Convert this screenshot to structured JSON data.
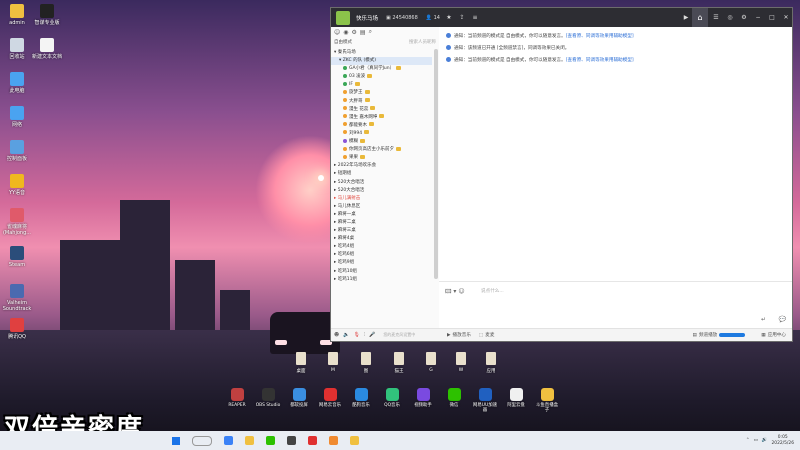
{
  "desktop_icons": [
    {
      "label": "admin",
      "color": "#f0c040"
    },
    {
      "label": "回收站",
      "color": "#cfd8e3"
    },
    {
      "label": "此电脑",
      "color": "#4aa3f0"
    },
    {
      "label": "网络",
      "color": "#4aa3f0"
    },
    {
      "label": "控制面板",
      "color": "#5aa0e0"
    },
    {
      "label": "YY语音",
      "color": "#f0b81e"
    },
    {
      "label": "雀魂麻将 (Mahjong...",
      "color": "#e05a6a"
    },
    {
      "label": "Steam",
      "color": "#2b4d7a"
    },
    {
      "label": "Valheim Soundtrack",
      "color": "#4a6ab0"
    },
    {
      "label": "腾讯QQ",
      "color": "#e04040"
    }
  ],
  "desktop_icons_col2": [
    {
      "label": "智谋专业版",
      "color": "#222"
    },
    {
      "label": "新建文本文档",
      "color": "#f4f4f4"
    }
  ],
  "qq": {
    "title": "快乐马场",
    "id": "24540868",
    "members": "14",
    "sidebar_mode": "自由模式",
    "sidebar_search_hint": "搜索人员昵称",
    "channel_main": "秦氏马场",
    "channel_sub": "ZKC 的队 (模式)",
    "members_list": [
      {
        "name": "GA小君（真同学Jun）",
        "dot": "#3aa757"
      },
      {
        "name": "03 凌波",
        "dot": "#3aa757"
      },
      {
        "name": "IF",
        "dot": "#3aa757"
      },
      {
        "name": "旋梦王",
        "dot": "#f0a030"
      },
      {
        "name": "大胖哥",
        "dot": "#f0a030"
      },
      {
        "name": "漫生 花蕊",
        "dot": "#f0a030"
      },
      {
        "name": "漫生 嘉木网坤",
        "dot": "#f0a030"
      },
      {
        "name": "都能要木",
        "dot": "#f0a030"
      },
      {
        "name": "刘994",
        "dot": "#f0a030"
      },
      {
        "name": "模糊",
        "dot": "#8a55d8"
      },
      {
        "name": "你网页高店主小乐前夕",
        "dot": "#f0a030"
      },
      {
        "name": "果果",
        "dot": "#f0a030"
      }
    ],
    "channels": [
      {
        "name": "2022年马场欢乐会"
      },
      {
        "name": "短期组"
      },
      {
        "name": "520大合唱活"
      },
      {
        "name": "520大合唱活"
      },
      {
        "name": "马儿满射击",
        "red": true
      },
      {
        "name": "马儿休息区"
      },
      {
        "name": "麻将一桌"
      },
      {
        "name": "麻将二桌"
      },
      {
        "name": "麻将三桌"
      },
      {
        "name": "麻将4桌"
      },
      {
        "name": "吃鸡4组"
      },
      {
        "name": "吃鸡6组"
      },
      {
        "name": "吃鸡9组"
      },
      {
        "name": "吃鸡10组"
      },
      {
        "name": "吃鸡11组"
      }
    ],
    "sidebar_bottom_hint": "您的麦克风设置中",
    "messages": [
      {
        "text": "通知：当前频道的模式是 自由模式，你可以随意发言。",
        "link": "[查看原、同调等效果用辅助模型]"
      },
      {
        "text": "通知：该频道已开通 [全频道禁言]，同调等效果已关闭。",
        "link": ""
      },
      {
        "text": "通知：当前频道的模式是 自由模式，你可以随意发言。",
        "link": "[查看原、同调等效果用辅助模型]"
      }
    ],
    "input_placeholder": "说点什么...",
    "bottom_bar": {
      "video_label": "播放音乐",
      "share_label": "麦麦",
      "volume_label": "频道播放",
      "app_label": "应用中心"
    }
  },
  "dock_folders": [
    "桌面",
    "M",
    "图",
    "猫王",
    "G",
    "W",
    "应用"
  ],
  "apps": [
    {
      "label": "REAPER",
      "color": "#c04040"
    },
    {
      "label": "OBS Studio",
      "color": "#333"
    },
    {
      "label": "都软投屏",
      "color": "#3a8ee0"
    },
    {
      "label": "网易云音乐",
      "color": "#e03030"
    },
    {
      "label": "酷狗音乐",
      "color": "#2a8ae0"
    },
    {
      "label": "QQ音乐",
      "color": "#31c27c"
    },
    {
      "label": "视频助手",
      "color": "#7a4ae0"
    },
    {
      "label": "微信",
      "color": "#2dc100"
    },
    {
      "label": "网易UU加速器",
      "color": "#2060c0"
    },
    {
      "label": "阿里云盘",
      "color": "#f0f0f0"
    },
    {
      "label": "斗鱼直播盒子",
      "color": "#f0c040"
    }
  ],
  "subtitle": "双倍亲密度",
  "clock": {
    "time": "0:05",
    "date": "2022/5/26"
  }
}
